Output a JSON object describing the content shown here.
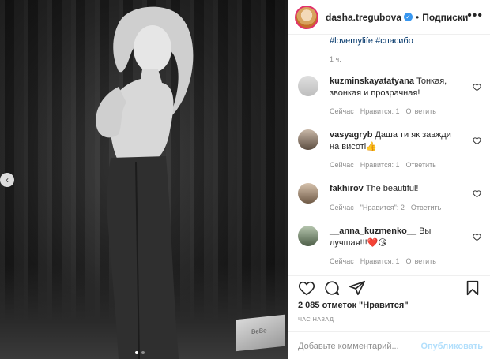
{
  "header": {
    "username": "dasha.tregubova",
    "separator": "•",
    "follow_label": "Подписки",
    "more_label": "•••",
    "verified_mark": "✓"
  },
  "caption": {
    "hashtags": "#lovemylife #спасибо",
    "time": "1 ч."
  },
  "comments": [
    {
      "user": "kuzminskayatatyana",
      "text": "Тонкая, звонкая и прозрачная!",
      "time": "Сейчас",
      "likes": "Нравится: 1",
      "reply": "Ответить"
    },
    {
      "user": "vasyagryb",
      "text": "Даша ти як завжди на висоті👍",
      "time": "Сейчас",
      "likes": "Нравится: 1",
      "reply": "Ответить"
    },
    {
      "user": "fakhirov",
      "text": "The beautiful!",
      "time": "Сейчас",
      "likes": "\"Нравится\": 2",
      "reply": "Ответить"
    },
    {
      "user": "__anna_kuzmenko__",
      "text": "Вы лучшая!!!❤️😘",
      "time": "Сейчас",
      "likes": "Нравится: 1",
      "reply": "Ответить"
    }
  ],
  "likes_count": "2 085 отметок \"Нравится\"",
  "posted_time": "ЧАС НАЗАД",
  "composer": {
    "placeholder": "Добавьте комментарий...",
    "publish_label": "Опубликовать"
  },
  "photo": {
    "box_label": "BeBe",
    "prev_arrow": "‹"
  },
  "icons": {
    "like": "heart-icon",
    "comment": "comment-icon",
    "share": "paper-plane-icon",
    "save": "bookmark-icon"
  },
  "colors": {
    "link": "#003569",
    "muted": "#8e8e8e",
    "publish": "#b2dffc",
    "verified": "#3897f0"
  }
}
